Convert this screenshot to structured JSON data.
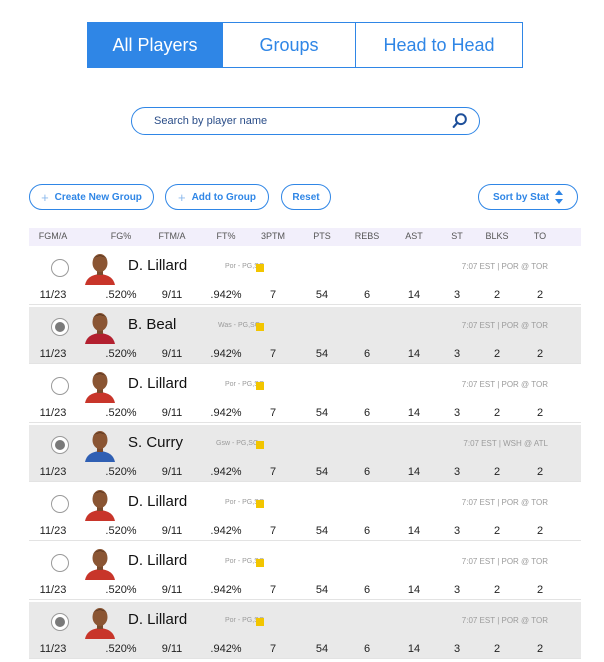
{
  "tabs": [
    {
      "label": "All Players",
      "active": true
    },
    {
      "label": "Groups",
      "active": false
    },
    {
      "label": "Head to Head",
      "active": false
    }
  ],
  "search": {
    "placeholder": "Search by player name",
    "icon": "search-icon"
  },
  "actions": {
    "create_group": "Create New Group",
    "add_to_group": "Add to Group",
    "reset": "Reset",
    "sort": "Sort by Stat"
  },
  "columns": [
    "FGM/A",
    "FG%",
    "FTM/A",
    "FT%",
    "3PTM",
    "PTS",
    "REBS",
    "AST",
    "ST",
    "BLKS",
    "TO"
  ],
  "colors": {
    "accent": "#2f86e6",
    "badge": "#f2c500",
    "selected_row": "#e9e9e9"
  },
  "players": [
    {
      "name": "D. Lillard",
      "meta": "Por - PG,SG",
      "game": "7:07 EST  |  POR @ TOR",
      "selected": false,
      "stats": [
        "11/23",
        ".520%",
        "9/11",
        ".942%",
        "7",
        "54",
        "6",
        "14",
        "3",
        "2",
        "2"
      ]
    },
    {
      "name": "B. Beal",
      "meta": "Was - PG,SG",
      "game": "7:07 EST  |  POR @ TOR",
      "selected": true,
      "stats": [
        "11/23",
        ".520%",
        "9/11",
        ".942%",
        "7",
        "54",
        "6",
        "14",
        "3",
        "2",
        "2"
      ]
    },
    {
      "name": "D. Lillard",
      "meta": "Por - PG,SG",
      "game": "7:07 EST  |  POR @ TOR",
      "selected": false,
      "stats": [
        "11/23",
        ".520%",
        "9/11",
        ".942%",
        "7",
        "54",
        "6",
        "14",
        "3",
        "2",
        "2"
      ]
    },
    {
      "name": "S. Curry",
      "meta": "Gsw - PG,SG",
      "game": "7:07 EST  |  WSH @ ATL",
      "selected": true,
      "stats": [
        "11/23",
        ".520%",
        "9/11",
        ".942%",
        "7",
        "54",
        "6",
        "14",
        "3",
        "2",
        "2"
      ]
    },
    {
      "name": "D. Lillard",
      "meta": "Por - PG,SG",
      "game": "7:07 EST  |  POR @ TOR",
      "selected": false,
      "stats": [
        "11/23",
        ".520%",
        "9/11",
        ".942%",
        "7",
        "54",
        "6",
        "14",
        "3",
        "2",
        "2"
      ]
    },
    {
      "name": "D. Lillard",
      "meta": "Por - PG,SG",
      "game": "7:07 EST  |  POR @ TOR",
      "selected": false,
      "stats": [
        "11/23",
        ".520%",
        "9/11",
        ".942%",
        "7",
        "54",
        "6",
        "14",
        "3",
        "2",
        "2"
      ]
    },
    {
      "name": "D. Lillard",
      "meta": "Por - PG,SG",
      "game": "7:07 EST  |  POR @ TOR",
      "selected": true,
      "stats": [
        "11/23",
        ".520%",
        "9/11",
        ".942%",
        "7",
        "54",
        "6",
        "14",
        "3",
        "2",
        "2"
      ]
    }
  ]
}
